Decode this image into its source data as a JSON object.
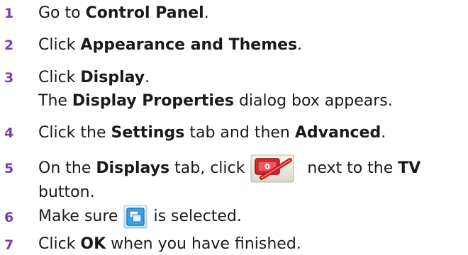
{
  "steps": [
    {
      "number": "1",
      "pre": "Go to ",
      "bold": "Control Panel",
      "post": "."
    },
    {
      "number": "2",
      "pre": "Click ",
      "bold": "Appearance and Themes",
      "post": "."
    },
    {
      "number": "3",
      "pre": "Click ",
      "bold": "Display",
      "post": ".",
      "line2_pre": "The ",
      "line2_bold": "Display Properties",
      "line2_post": " dialog box appears."
    },
    {
      "number": "4",
      "pre": "Click the ",
      "bold": "Settings",
      "mid": " tab and then ",
      "bold2": "Advanced",
      "post": "."
    },
    {
      "number": "5",
      "pre": "On the ",
      "bold": "Displays",
      "mid": " tab, click",
      "after_icon": "next to the ",
      "bold2": "TV",
      "line2": "button.",
      "icon": "tv-toggle-icon"
    },
    {
      "number": "6",
      "pre": "Make sure",
      "post": "is selected.",
      "icon": "display-window-icon"
    },
    {
      "number": "7",
      "pre": "Click ",
      "bold": "OK",
      "post": " when you have finished."
    }
  ],
  "colors": {
    "step_number": "#7b3fa8",
    "text": "#1a1a1a"
  }
}
